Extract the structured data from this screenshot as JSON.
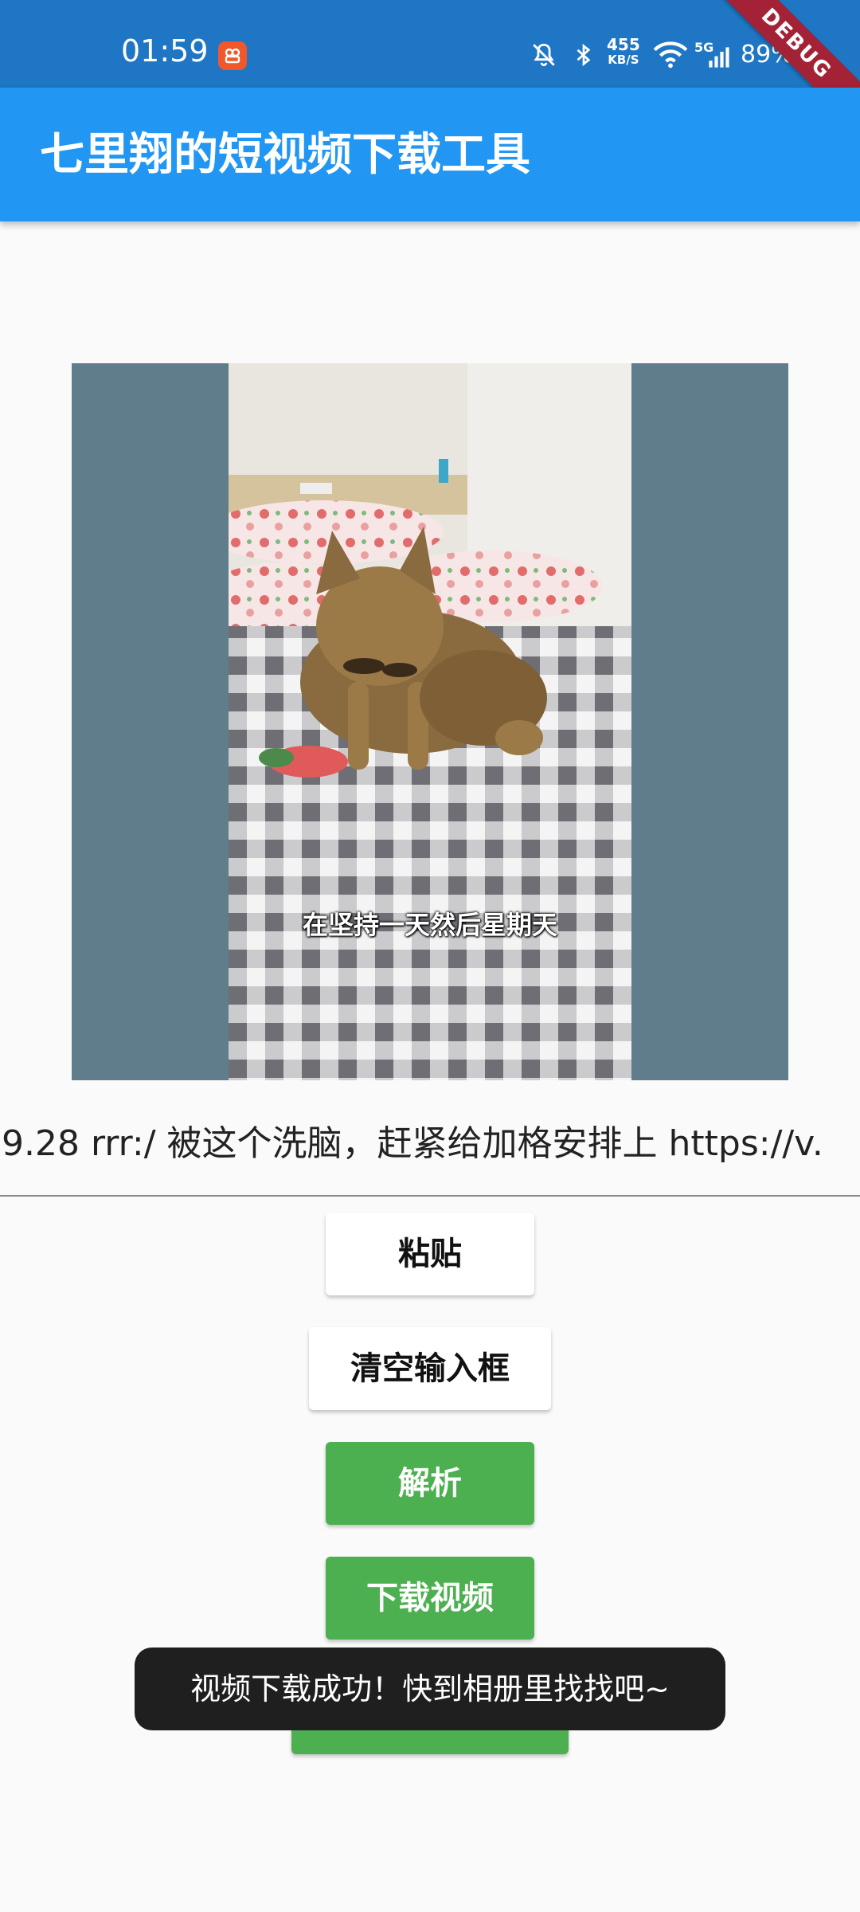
{
  "status_bar": {
    "time": "01:59",
    "network_speed": "455",
    "network_speed_unit": "KB/S",
    "network_type": "5G",
    "battery": "89%",
    "icons": [
      "notification-app-icon",
      "mute-icon",
      "bluetooth-icon",
      "wifi-icon",
      "cellular-signal-icon",
      "battery-icon"
    ]
  },
  "debug_banner": "DEBUG",
  "app_bar": {
    "title": "七里翔的短视频下载工具"
  },
  "video": {
    "subtitle": "在坚持一天然后星期天"
  },
  "input": {
    "value": "9.28 rrr:/ 被这个洗脑，赶紧给加格安排上  https://v."
  },
  "buttons": {
    "paste": "粘贴",
    "clear": "清空输入框",
    "parse": "解析",
    "download": "下载视频"
  },
  "toast": "视频下载成功！快到相册里找找吧~",
  "colors": {
    "status_bar": "#1E76C4",
    "app_bar": "#2196F3",
    "video_bg": "#607D8B",
    "green": "#4CAF50",
    "toast_bg": "#1F1F1F"
  }
}
